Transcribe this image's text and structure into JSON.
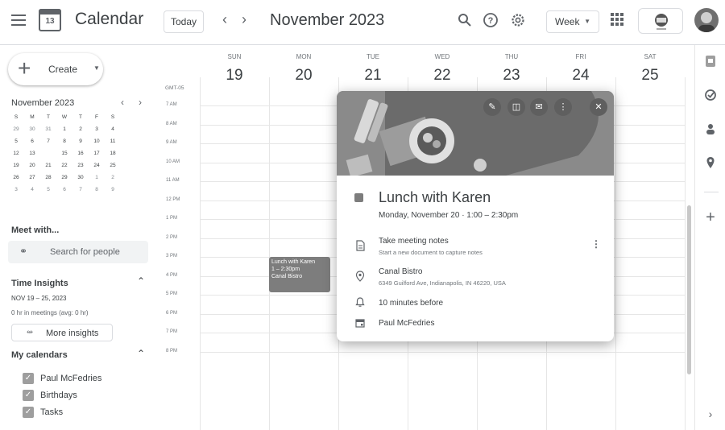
{
  "header": {
    "app_title": "Calendar",
    "logo_day": "13",
    "today_label": "Today",
    "month_title": "November 2023",
    "view_label": "Week",
    "icons": [
      "menu-icon",
      "calendar-logo-icon",
      "chevron-left-icon",
      "chevron-right-icon",
      "search-icon",
      "help-icon",
      "settings-icon",
      "apps-grid-icon"
    ]
  },
  "sidebar": {
    "create_label": "Create",
    "mini_calendar": {
      "title": "November 2023",
      "weekdays": [
        "S",
        "M",
        "T",
        "W",
        "T",
        "F",
        "S"
      ],
      "weeks": [
        [
          "29",
          "30",
          "31",
          "1",
          "2",
          "3",
          "4"
        ],
        [
          "5",
          "6",
          "7",
          "8",
          "9",
          "10",
          "11"
        ],
        [
          "12",
          "13",
          "14",
          "15",
          "16",
          "17",
          "18"
        ],
        [
          "19",
          "20",
          "21",
          "22",
          "23",
          "24",
          "25"
        ],
        [
          "26",
          "27",
          "28",
          "29",
          "30",
          "1",
          "2"
        ],
        [
          "3",
          "4",
          "5",
          "6",
          "7",
          "8",
          "9"
        ]
      ],
      "selected_day": "14",
      "highlighted_day": "21"
    },
    "meet_with_title": "Meet with...",
    "search_people_placeholder": "Search for people",
    "time_insights": {
      "title": "Time Insights",
      "range": "NOV 19 – 25, 2023",
      "meetings": "0 hr in meetings (avg: 0 hr)",
      "more_label": "More insights"
    },
    "my_calendars": {
      "title": "My calendars",
      "items": [
        "Paul McFedries",
        "Birthdays",
        "Tasks"
      ]
    }
  },
  "week": {
    "timezone": "GMT-05",
    "days": [
      {
        "dow": "SUN",
        "num": "19"
      },
      {
        "dow": "MON",
        "num": "20"
      },
      {
        "dow": "TUE",
        "num": "21"
      },
      {
        "dow": "WED",
        "num": "22"
      },
      {
        "dow": "THU",
        "num": "23"
      },
      {
        "dow": "FRI",
        "num": "24"
      },
      {
        "dow": "SAT",
        "num": "25"
      }
    ],
    "hours": [
      "7 AM",
      "8 AM",
      "9 AM",
      "10 AM",
      "11 AM",
      "12 PM",
      "1 PM",
      "2 PM",
      "3 PM",
      "4 PM",
      "5 PM",
      "6 PM",
      "7 PM",
      "8 PM"
    ]
  },
  "event_chip": {
    "title": "Lunch with Karen",
    "time": "1 – 2:30pm",
    "location": "Canal Bistro"
  },
  "popup": {
    "title": "Lunch with Karen",
    "when": "Monday, November 20  ·  1:00 – 2:30pm",
    "notes_title": "Take meeting notes",
    "notes_sub": "Start a new document to capture notes",
    "place_name": "Canal Bistro",
    "place_address": "6349 Guilford Ave, Indianapolis, IN 46220, USA",
    "reminder": "10 minutes before",
    "organizer": "Paul McFedries"
  },
  "colors": {
    "event": "#7d7d7d",
    "selected_day": "#5f6368",
    "grid": "#e6e6e6"
  }
}
